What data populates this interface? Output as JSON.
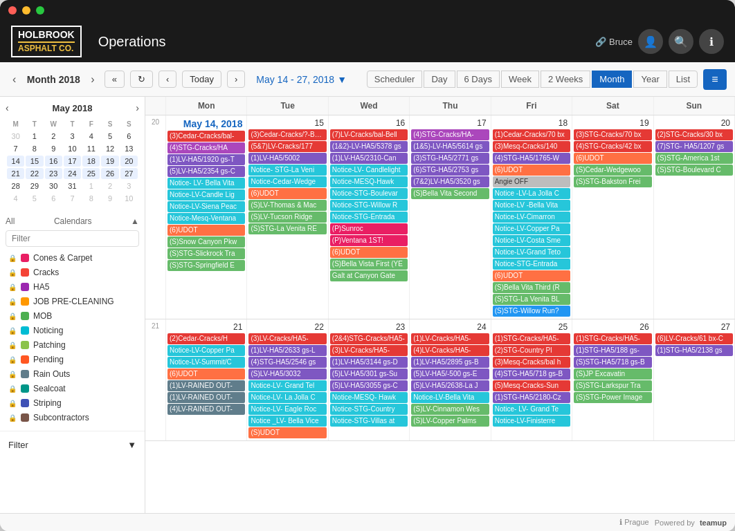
{
  "app": {
    "title": "Operations",
    "user": "Bruce"
  },
  "logo": {
    "line1": "HOLBROOK",
    "line2": "ASPHALT CO."
  },
  "toolbar": {
    "prev_month": "‹",
    "next_month": "›",
    "month": "Month",
    "year": "2018",
    "fast_prev": "«",
    "fast_next": "»",
    "refresh": "↻",
    "nav_prev": "‹",
    "nav_next": "›",
    "today": "Today",
    "date_range": "May 14 - 27, 2018",
    "scheduler": "Scheduler",
    "day": "Day",
    "six_days": "6 Days",
    "week": "Week",
    "two_weeks": "2 Weeks",
    "year_view": "Year",
    "list": "List"
  },
  "mini_cal": {
    "month": "May",
    "year": "2018",
    "days_header": [
      "M",
      "T",
      "W",
      "T",
      "F",
      "S",
      "S"
    ],
    "weeks": [
      [
        "30",
        "1",
        "2",
        "3",
        "4",
        "5",
        "6"
      ],
      [
        "7",
        "8",
        "9",
        "10",
        "11",
        "12",
        "13"
      ],
      [
        "14",
        "15",
        "16",
        "17",
        "18",
        "19",
        "20"
      ],
      [
        "21",
        "22",
        "23",
        "24",
        "25",
        "26",
        "27"
      ],
      [
        "28",
        "29",
        "30",
        "31",
        "1",
        "2",
        "3"
      ],
      [
        "4",
        "5",
        "6",
        "7",
        "8",
        "9",
        "10"
      ]
    ]
  },
  "sidebar": {
    "calendars_label": "Calendars",
    "filter_placeholder": "Filter",
    "items": [
      {
        "name": "Cones & Carpet",
        "color": "#e91e63"
      },
      {
        "name": "Cracks",
        "color": "#f44336"
      },
      {
        "name": "HA5",
        "color": "#9c27b0"
      },
      {
        "name": "JOB PRE-CLEANING",
        "color": "#ff9800"
      },
      {
        "name": "MOB",
        "color": "#4caf50"
      },
      {
        "name": "Noticing",
        "color": "#00bcd4"
      },
      {
        "name": "Patching",
        "color": "#8bc34a"
      },
      {
        "name": "Pending",
        "color": "#ff5722"
      },
      {
        "name": "Rain Outs",
        "color": "#607d8b"
      },
      {
        "name": "Sealcoat",
        "color": "#009688"
      },
      {
        "name": "Striping",
        "color": "#3f51b5"
      },
      {
        "name": "Subcontractors",
        "color": "#795548"
      }
    ],
    "filter_btn": "Filter"
  },
  "calendar": {
    "week_num_1": "20",
    "week_num_2": "21",
    "day_headers": [
      "Mon",
      "Tue",
      "Wed",
      "Thu",
      "Fri",
      "Sat",
      "Sun"
    ],
    "week1": {
      "dates": [
        "14",
        "15",
        "16",
        "17",
        "18",
        "19",
        "20"
      ],
      "events": {
        "mon": [
          {
            "text": "(3)Cedar-Cracks/bal-",
            "color": "#e53935"
          },
          {
            "text": "(4)STG-Cracks/HA",
            "color": "#ab47bc"
          },
          {
            "text": "(1)LV-HA5/1920 gs-T",
            "color": "#7e57c2"
          },
          {
            "text": "(5)LV-HA5/2354 gs-C",
            "color": "#7e57c2"
          },
          {
            "text": "Notice- LV- Bella Vita",
            "color": "#26c6da"
          },
          {
            "text": "Notice-LV-Candle Lig",
            "color": "#26c6da"
          },
          {
            "text": "Notice-LV-Siena Peac",
            "color": "#26c6da"
          },
          {
            "text": "Notice-Mesq-Ventana",
            "color": "#26c6da"
          },
          {
            "text": "(6)UDOT",
            "color": "#ff7043"
          },
          {
            "text": "(S)Snow Canyon Pkw",
            "color": "#66bb6a"
          },
          {
            "text": "(S)STG-Slickrock Tra",
            "color": "#66bb6a"
          },
          {
            "text": "(S)STG-Springfield E",
            "color": "#66bb6a"
          }
        ],
        "tue": [
          {
            "text": "(3)Cedar-Cracks/?-Bella",
            "color": "#e53935"
          },
          {
            "text": "(5&7)LV-Cracks/177",
            "color": "#e53935"
          },
          {
            "text": "(1)LV-HA5/5002",
            "color": "#7e57c2"
          },
          {
            "text": "Notice- STG-La Veni",
            "color": "#26c6da"
          },
          {
            "text": "Notice-Cedar-Wedge",
            "color": "#26c6da"
          },
          {
            "text": "(6)UDOT",
            "color": "#ff7043"
          },
          {
            "text": "(S)LV-Thomas & Mac",
            "color": "#66bb6a"
          },
          {
            "text": "(S)LV-Tucson Ridge",
            "color": "#66bb6a"
          },
          {
            "text": "(S)STG-La Venita RE",
            "color": "#66bb6a"
          }
        ],
        "wed": [
          {
            "text": "(7)LV-Cracks/bal-Bell",
            "color": "#e53935"
          },
          {
            "text": "(1&2)-LV-HA5/5378 gs",
            "color": "#7e57c2"
          },
          {
            "text": "(1)LV-HA5/2310-Can",
            "color": "#7e57c2"
          },
          {
            "text": "Notice-LV- Candlelight",
            "color": "#26c6da"
          },
          {
            "text": "Notice-MESQ-Hawk",
            "color": "#26c6da"
          },
          {
            "text": "Notice-STG-Boulevar",
            "color": "#26c6da"
          },
          {
            "text": "Notice-STG-Willow R",
            "color": "#26c6da"
          },
          {
            "text": "Notice-STG-Entrada",
            "color": "#26c6da"
          },
          {
            "text": "(P)Sunroc",
            "color": "#e91e63"
          },
          {
            "text": "(P)Ventana 1ST!",
            "color": "#e91e63"
          },
          {
            "text": "(6)UDOT",
            "color": "#ff7043"
          },
          {
            "text": "(S)Bella Vista First (YE",
            "color": "#66bb6a"
          },
          {
            "text": "Galt at Canyon Gate",
            "color": "#66bb6a"
          }
        ],
        "thu": [
          {
            "text": "(4)STG-Cracks/HA-",
            "color": "#ab47bc"
          },
          {
            "text": "(1&5)-LV-HA5/5614 gs",
            "color": "#7e57c2"
          },
          {
            "text": "(3)STG-HA5/2771 gs",
            "color": "#7e57c2"
          },
          {
            "text": "(6)STG-HA5/2753 gs",
            "color": "#7e57c2"
          },
          {
            "text": "(7&2)LV-HA5/3520 gs",
            "color": "#7e57c2"
          },
          {
            "text": "(S)Bella Vita Second",
            "color": "#66bb6a"
          }
        ],
        "fri": [
          {
            "text": "(1)Cedar-Cracks/70 bx",
            "color": "#e53935"
          },
          {
            "text": "(3)Mesq-Cracks/140",
            "color": "#e53935"
          },
          {
            "text": "(4)STG-HA5/1765-W",
            "color": "#7e57c2"
          },
          {
            "text": "(6)UDOT",
            "color": "#ff7043"
          },
          {
            "text": "Angie OFF",
            "color": "#bdbdbd"
          },
          {
            "text": "Notice -LV-La Jolla C",
            "color": "#26c6da"
          },
          {
            "text": "Notice-LV -Bella Vita",
            "color": "#26c6da"
          },
          {
            "text": "Notice-LV-Cimarron",
            "color": "#26c6da"
          },
          {
            "text": "Notice-LV-Copper Pa",
            "color": "#26c6da"
          },
          {
            "text": "Notice-LV-Costa Sme",
            "color": "#26c6da"
          },
          {
            "text": "Notice-LV-Grand Teto",
            "color": "#26c6da"
          },
          {
            "text": "Notice-STG-Entrada",
            "color": "#26c6da"
          },
          {
            "text": "(6)UDOT",
            "color": "#ff7043"
          },
          {
            "text": "(S)Bella Vita Third (R",
            "color": "#66bb6a"
          },
          {
            "text": "(S)STG-La Venita BL",
            "color": "#66bb6a"
          },
          {
            "text": "(S)STG-Willow Run?",
            "color": "#2196f3"
          }
        ],
        "sat": [
          {
            "text": "(3)STG-Cracks/70 bx",
            "color": "#e53935"
          },
          {
            "text": "(4)STG-Cracks/42 bx",
            "color": "#e53935"
          },
          {
            "text": "(6)UDOT",
            "color": "#ff7043"
          },
          {
            "text": "(S)Cedar-Wedgewoo",
            "color": "#66bb6a"
          },
          {
            "text": "(S)STG-Bakston Frei",
            "color": "#66bb6a"
          }
        ],
        "sun": [
          {
            "text": "(2)STG-Cracks/30 bx",
            "color": "#e53935"
          },
          {
            "text": "(7)STG- HA5/1207 gs",
            "color": "#7e57c2"
          },
          {
            "text": "(S)STG-America 1st",
            "color": "#66bb6a"
          },
          {
            "text": "(S)STG-Boulevard C",
            "color": "#66bb6a"
          }
        ]
      }
    },
    "week2": {
      "dates": [
        "21",
        "22",
        "23",
        "24",
        "25",
        "26",
        "27"
      ],
      "events": {
        "mon": [
          {
            "text": "(2)Cedar-Cracks/H",
            "color": "#e53935"
          },
          {
            "text": "Notice-LV-Copper Pa",
            "color": "#26c6da"
          },
          {
            "text": "Notice-LV-Summit/C",
            "color": "#26c6da"
          },
          {
            "text": "(6)UDOT",
            "color": "#ff7043"
          },
          {
            "text": "(1)LV-RAINED OUT-",
            "color": "#607d8b"
          },
          {
            "text": "(1)LV-RAINED OUT-",
            "color": "#607d8b"
          },
          {
            "text": "(4)LV-RAINED OUT-",
            "color": "#607d8b"
          }
        ],
        "tue": [
          {
            "text": "(3)LV-Cracks/HA5-",
            "color": "#e53935"
          },
          {
            "text": "(1)LV-HA5/2633 gs-L",
            "color": "#7e57c2"
          },
          {
            "text": "(4)STG-HA5/2546 gs",
            "color": "#7e57c2"
          },
          {
            "text": "(S)LV-HA5/3032",
            "color": "#7e57c2"
          },
          {
            "text": "Notice-LV- Grand Tel",
            "color": "#26c6da"
          },
          {
            "text": "Notice-LV- La Jolla C",
            "color": "#26c6da"
          },
          {
            "text": "Notice-LV- Eagle Roc",
            "color": "#26c6da"
          },
          {
            "text": "Notice _LV- Bella Vice",
            "color": "#26c6da"
          },
          {
            "text": "(S)UDOT",
            "color": "#ff7043"
          }
        ],
        "wed": [
          {
            "text": "(2&4)STG-Cracks/HA5-",
            "color": "#e53935"
          },
          {
            "text": "(3)LV-Cracks/HA5-",
            "color": "#e53935"
          },
          {
            "text": "(1)LV-HA5/3144 gs-D",
            "color": "#7e57c2"
          },
          {
            "text": "(5)LV-HA5/301 gs-Su",
            "color": "#7e57c2"
          },
          {
            "text": "(5)LV-HA5/3055 gs-C",
            "color": "#7e57c2"
          },
          {
            "text": "Notice-MESQ- Hawk",
            "color": "#26c6da"
          },
          {
            "text": "Notice-STG-Country",
            "color": "#26c6da"
          },
          {
            "text": "Notice-STG-Villas at",
            "color": "#26c6da"
          }
        ],
        "thu": [
          {
            "text": "(1)LV-Cracks/HA5-",
            "color": "#e53935"
          },
          {
            "text": "(4)LV-Cracks/HA5-",
            "color": "#e53935"
          },
          {
            "text": "(1)LV-HA5/2895 gs-B",
            "color": "#7e57c2"
          },
          {
            "text": "(5)LV-HA5/-500 gs-E",
            "color": "#7e57c2"
          },
          {
            "text": "(5)LV-HA5/2638-La J",
            "color": "#7e57c2"
          },
          {
            "text": "Notice-LV-Bella Vita",
            "color": "#26c6da"
          },
          {
            "text": "(S)LV-Cinnamon Wes",
            "color": "#66bb6a"
          },
          {
            "text": "(S)LV-Copper Palms",
            "color": "#66bb6a"
          }
        ],
        "fri": [
          {
            "text": "(1)STG-Cracks/HA5-",
            "color": "#e53935"
          },
          {
            "text": "(2)STG-Country Pl",
            "color": "#e53935"
          },
          {
            "text": "(3)Mesq-Cracks/bal h",
            "color": "#e53935"
          },
          {
            "text": "(4)STG-HA5/718 gs-B",
            "color": "#7e57c2"
          },
          {
            "text": "(5)Mesq-Cracks-Sun",
            "color": "#e53935"
          },
          {
            "text": "(1)STG-HA5/2180-Cz",
            "color": "#7e57c2"
          },
          {
            "text": "Notice- LV- Grand Te",
            "color": "#26c6da"
          },
          {
            "text": "Notice-LV-Finisterre",
            "color": "#26c6da"
          }
        ],
        "sat": [
          {
            "text": "(1)STG-Cracks/HA5-",
            "color": "#e53935"
          },
          {
            "text": "(1)STG-HA5/188 gs-",
            "color": "#7e57c2"
          },
          {
            "text": "(S)STG-HA5/718 gs-B",
            "color": "#7e57c2"
          },
          {
            "text": "(S)JP Excavatin",
            "color": "#66bb6a"
          },
          {
            "text": "(S)STG-Larkspur Tra",
            "color": "#66bb6a"
          },
          {
            "text": "(S)STG-Power Image",
            "color": "#66bb6a"
          }
        ],
        "sun": [
          {
            "text": "(6)LV-Cracks/61 bx-C",
            "color": "#e53935"
          },
          {
            "text": "(1)STG-HA5/2138 gs",
            "color": "#7e57c2"
          }
        ]
      }
    }
  },
  "footer": {
    "timezone": "Prague",
    "powered_by": "Powered by",
    "platform": "teamup"
  }
}
